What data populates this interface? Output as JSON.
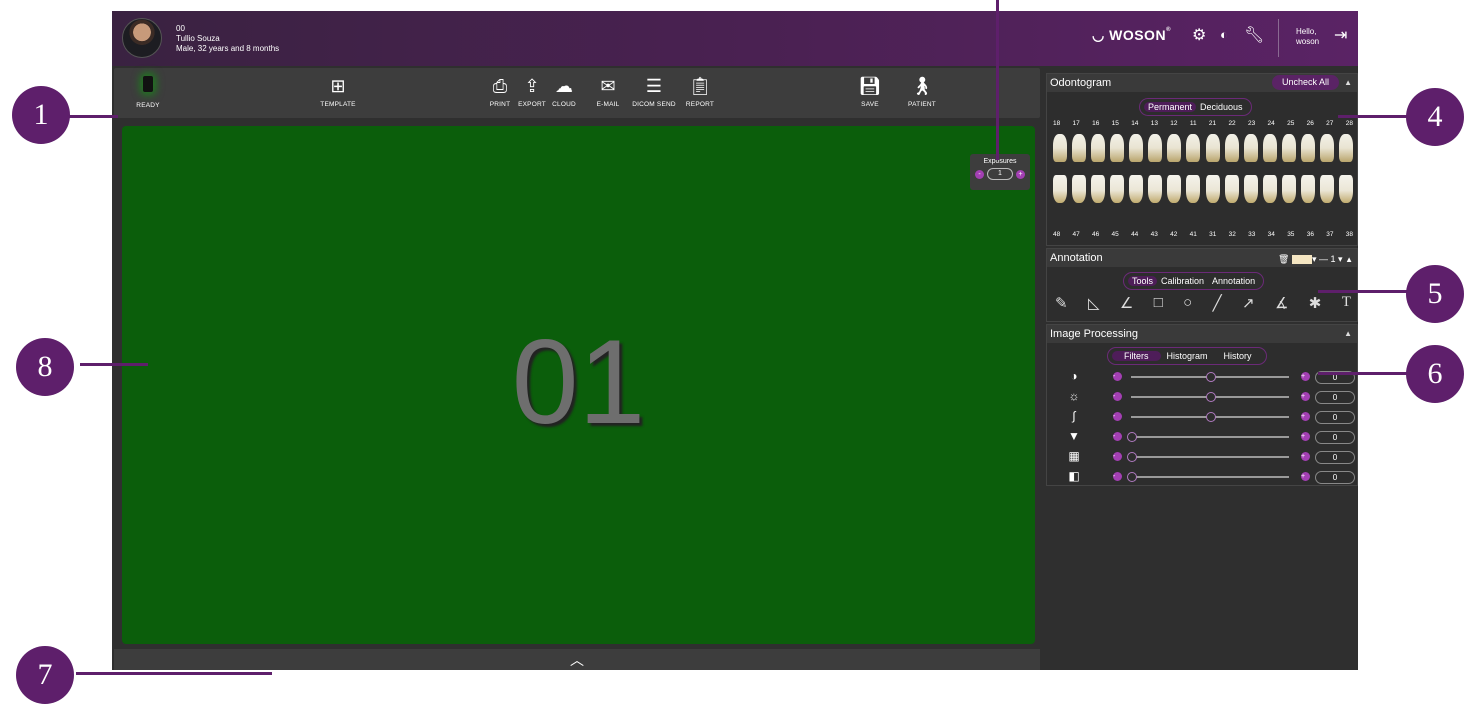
{
  "colors": {
    "header": "#4b2153",
    "accent": "#a33fb3",
    "canvas": "#0b5e0b",
    "callout": "#5e1f6b"
  },
  "patient": {
    "id": "00",
    "name": "Tullio Souza",
    "details": "Male, 32 years and 8 months"
  },
  "header": {
    "brand": "WOSON",
    "brand_mark": "®",
    "icons": [
      "gear-icon",
      "contrast-icon",
      "wrench-icon"
    ],
    "greeting": "Hello,",
    "user": "woson"
  },
  "toolbar": {
    "ready": "READY",
    "template": "TEMPLATE",
    "print": "PRINT",
    "export": "EXPORT",
    "cloud": "CLOUD",
    "email": "E-MAIL",
    "dicom_send": "DICOM SEND",
    "report": "REPORT",
    "save": "SAVE",
    "patient": "PATIENT"
  },
  "exposures": {
    "label": "Exposures",
    "minus": "-",
    "value": "1",
    "plus": "+"
  },
  "canvas": {
    "label": "01"
  },
  "odontogram": {
    "title": "Odontogram",
    "uncheck_all": "Uncheck All",
    "tabs": [
      "Permanent",
      "Deciduous"
    ],
    "upper": [
      "18",
      "17",
      "16",
      "15",
      "14",
      "13",
      "12",
      "11",
      "21",
      "22",
      "23",
      "24",
      "25",
      "26",
      "27",
      "28"
    ],
    "lower": [
      "48",
      "47",
      "46",
      "45",
      "44",
      "43",
      "42",
      "41",
      "31",
      "32",
      "33",
      "34",
      "35",
      "36",
      "37",
      "38"
    ]
  },
  "annotation": {
    "title": "Annotation",
    "width_value": "1",
    "tabs": [
      "Tools",
      "Calibration",
      "Annotation"
    ],
    "tools": [
      "ruler-icon",
      "angle-triangle-icon",
      "angle-icon",
      "rectangle-icon",
      "circle-icon",
      "line-icon",
      "arrow-icon",
      "pencil-icon",
      "asterisk-icon",
      "text-icon"
    ]
  },
  "image_processing": {
    "title": "Image Processing",
    "tabs": [
      "Filters",
      "Histogram",
      "History"
    ],
    "filters": [
      {
        "icon": "contrast-icon",
        "value": "0",
        "level": 0.5
      },
      {
        "icon": "brightness-icon",
        "value": "0",
        "level": 0.5
      },
      {
        "icon": "gamma-icon",
        "value": "0",
        "level": 0.5
      },
      {
        "icon": "sharpen-icon",
        "value": "0",
        "level": 0
      },
      {
        "icon": "noise-icon",
        "value": "0",
        "level": 0
      },
      {
        "icon": "edge-icon",
        "value": "0",
        "level": 0
      }
    ]
  },
  "callouts": [
    "1",
    "4",
    "5",
    "6",
    "8",
    "7"
  ]
}
